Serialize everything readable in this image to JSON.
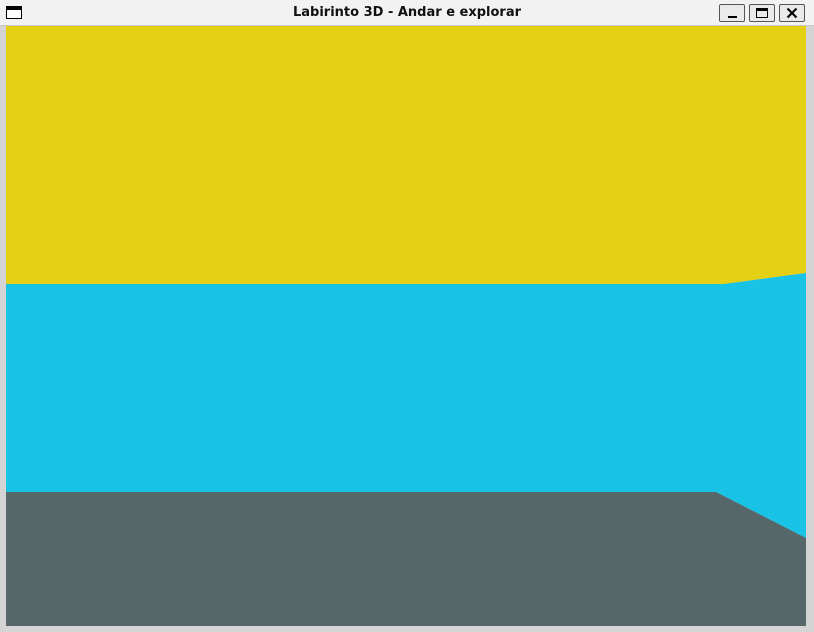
{
  "window": {
    "title": "Labirinto 3D - Andar e explorar",
    "app_icon": "window-icon",
    "buttons": {
      "minimize_icon": "minimize-icon",
      "maximize_icon": "maximize-icon",
      "close_icon": "close-icon"
    }
  },
  "scene": {
    "ceiling_color": "#e5d016",
    "wall_color": "#19c3e5",
    "floor_color": "#56676a"
  }
}
